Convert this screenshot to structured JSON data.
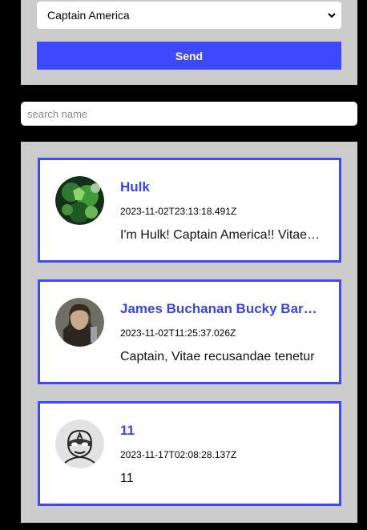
{
  "form": {
    "selected_character": "Captain America",
    "send_label": "Send"
  },
  "search": {
    "placeholder": "search name",
    "value": ""
  },
  "posts": [
    {
      "name": "Hulk",
      "timestamp": "2023-11-02T23:13:18.491Z",
      "message": "I'm Hulk! Captain America!! Vitae recusandae tenetur",
      "avatar": "hulk-avatar"
    },
    {
      "name": "James Buchanan Bucky Barnes",
      "timestamp": "2023-11-02T11:25:37.026Z",
      "message": "Captain, Vitae recusandae tenetur",
      "avatar": "bucky-avatar"
    },
    {
      "name": "11",
      "timestamp": "2023-11-17T02:08:28.137Z",
      "message": "11",
      "avatar": "default-hero-avatar"
    }
  ],
  "colors": {
    "accent": "#3d48ff",
    "name_text": "#3a44e8",
    "panel_bg": "#cccccc",
    "page_bg": "#000000"
  }
}
